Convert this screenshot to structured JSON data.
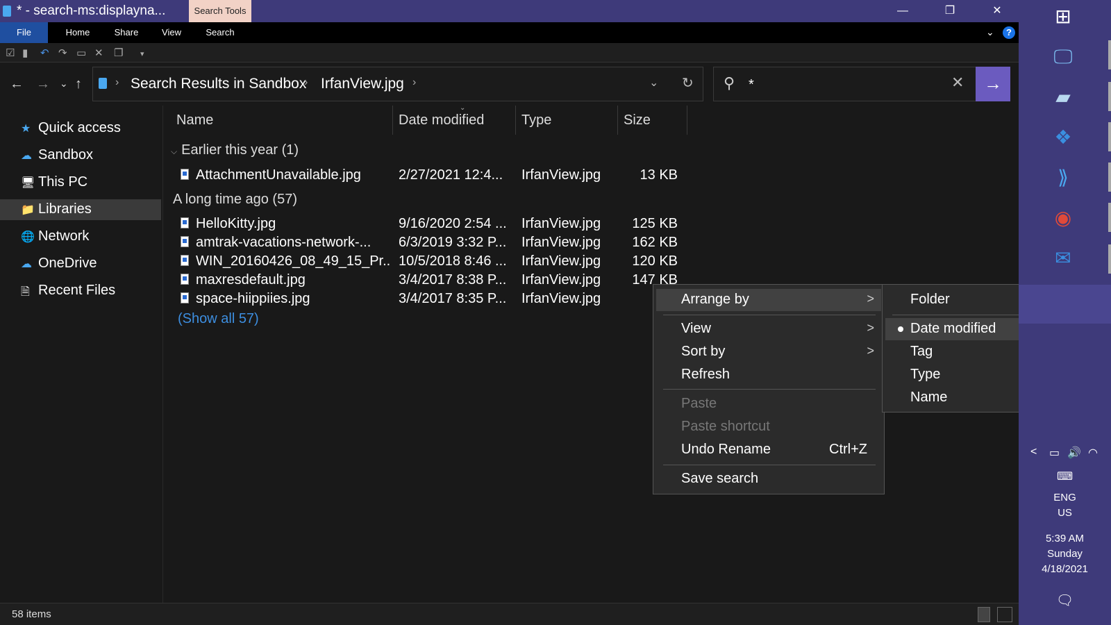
{
  "window": {
    "title": "* - search-ms:displayna...",
    "context_tab": "Search Tools",
    "min": "—",
    "max": "❐",
    "close": "✕"
  },
  "ribbon": {
    "tabs": [
      "File",
      "Home",
      "Share",
      "View",
      "Search"
    ],
    "collapse": "⌄",
    "help": "?"
  },
  "nav": {
    "back": "←",
    "forward": "→",
    "recent": "⌄",
    "up": "↑"
  },
  "address": {
    "crumbs": [
      "Search Results in Sandbox",
      "IrfanView.jpg"
    ],
    "sep": "›",
    "dropdown": "⌄",
    "refresh": "↻"
  },
  "search": {
    "value": "*",
    "clear": "✕",
    "go": "→",
    "icon": "⚲"
  },
  "navpane": [
    {
      "label": "Quick access",
      "icon": "★"
    },
    {
      "label": "Sandbox",
      "icon": "☁"
    },
    {
      "label": "This PC",
      "icon": "🖥"
    },
    {
      "label": "Libraries",
      "icon": "📁"
    },
    {
      "label": "Network",
      "icon": "🌐"
    },
    {
      "label": "OneDrive",
      "icon": "☁"
    },
    {
      "label": "Recent Files",
      "icon": "🗎"
    }
  ],
  "columns": [
    "Name",
    "Date modified",
    "Type",
    "Size"
  ],
  "groups": [
    {
      "label": "Earlier this year (1)"
    },
    {
      "label": "A long time ago (57)"
    }
  ],
  "files": [
    {
      "name": "AttachmentUnavailable.jpg",
      "date": "2/27/2021 12:4...",
      "type": "IrfanView.jpg",
      "size": "13 KB"
    },
    {
      "name": "HelloKitty.jpg",
      "date": "9/16/2020 2:54 ...",
      "type": "IrfanView.jpg",
      "size": "125 KB"
    },
    {
      "name": "amtrak-vacations-network-...",
      "date": "6/3/2019 3:32 P...",
      "type": "IrfanView.jpg",
      "size": "162 KB"
    },
    {
      "name": "WIN_20160426_08_49_15_Pr...",
      "date": "10/5/2018 8:46 ...",
      "type": "IrfanView.jpg",
      "size": "120 KB"
    },
    {
      "name": "maxresdefault.jpg",
      "date": "3/4/2017 8:38 P...",
      "type": "IrfanView.jpg",
      "size": "147 KB"
    },
    {
      "name": "space-hiippiies.jpg",
      "date": "3/4/2017 8:35 P...",
      "type": "IrfanView.jpg",
      "size": ""
    }
  ],
  "show_all": "(Show all 57)",
  "status": {
    "items": "58 items"
  },
  "context_menu": {
    "items": [
      {
        "label": "Arrange by",
        "submenu": true
      },
      {
        "label": "View",
        "submenu": true
      },
      {
        "label": "Sort by",
        "submenu": true
      },
      {
        "label": "Refresh"
      },
      {
        "label": "Paste",
        "disabled": true
      },
      {
        "label": "Paste shortcut",
        "disabled": true
      },
      {
        "label": "Undo Rename",
        "shortcut": "Ctrl+Z"
      },
      {
        "label": "Save search"
      }
    ],
    "arrow": ">"
  },
  "submenu": {
    "items": [
      "Folder",
      "Date modified",
      "Tag",
      "Type",
      "Name"
    ],
    "selected": "Date modified"
  },
  "taskbar": {
    "lang1": "ENG",
    "lang2": "US",
    "time": "5:39 AM",
    "day": "Sunday",
    "date": "4/18/2021",
    "tray_chevron": "<"
  },
  "colors": {
    "titlebar": "#3e3a7a",
    "accent": "#6b5bbf",
    "link": "#3d8ee0"
  }
}
